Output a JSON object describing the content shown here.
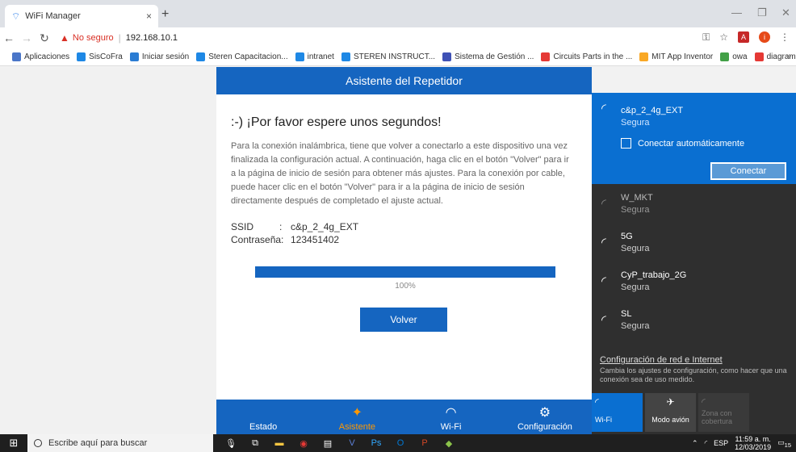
{
  "browser": {
    "tab_title": "WiFi Manager",
    "tab_close": "×",
    "new_tab": "+",
    "security_label": "No seguro",
    "url": "192.168.10.1",
    "bookmarks": [
      {
        "label": "Aplicaciones",
        "color": "#4a76c8"
      },
      {
        "label": "SisCoFra",
        "color": "#1e88e5"
      },
      {
        "label": "Iniciar sesión",
        "color": "#2b7cd3"
      },
      {
        "label": "Steren Capacitacion...",
        "color": "#1e88e5"
      },
      {
        "label": "intranet",
        "color": "#1e88e5"
      },
      {
        "label": "STEREN INSTRUCT...",
        "color": "#1e88e5"
      },
      {
        "label": "Sistema de Gestión ...",
        "color": "#3f51b5"
      },
      {
        "label": "Circuits Parts in the ...",
        "color": "#e53935"
      },
      {
        "label": "MIT App Inventor",
        "color": "#f9a825"
      },
      {
        "label": "owa",
        "color": "#43a047"
      },
      {
        "label": "diagramaOnline",
        "color": "#e53935"
      }
    ],
    "bookmarks_more": "»"
  },
  "page": {
    "header": "Asistente del Repetidor",
    "title": ":-) ¡Por favor espere unos segundos!",
    "paragraph": "Para la conexión inalámbrica, tiene que volver a conectarlo a este dispositivo una vez finalizada la configuración actual. A continuación, haga clic en el botón \"Volver\" para ir a la página de inicio de sesión para obtener más ajustes. Para la conexión por cable, puede hacer clic en el botón \"Volver\" para ir a la página de inicio de sesión directamente después de completado el ajuste actual.",
    "ssid_label": "SSID",
    "ssid_sep": ":",
    "ssid_value": "c&p_2_4g_EXT",
    "password_label": "Contraseña:",
    "password_value": "123451402",
    "progress_percent": 100,
    "progress_text": "100%",
    "back_button": "Volver",
    "nav": [
      {
        "label": "Estado",
        "icon": ""
      },
      {
        "label": "Asistente",
        "icon": "✦"
      },
      {
        "label": "Wi-Fi",
        "icon": "◠"
      },
      {
        "label": "Configuración",
        "icon": "⚙"
      }
    ],
    "accent_color": "#1565c0",
    "active_nav_color": "#ff9800"
  },
  "wifi_panel": {
    "selected": {
      "name": "c&p_2_4g_EXT",
      "security": "Segura",
      "auto_connect_label": "Conectar automáticamente",
      "connect_button": "Conectar"
    },
    "networks": [
      {
        "name": "W_MKT",
        "security": "Segura",
        "dim": true
      },
      {
        "name": "5G",
        "security": "Segura",
        "dim": false
      },
      {
        "name": "CyP_trabajo_2G",
        "security": "Segura",
        "dim": false
      },
      {
        "name": "SL",
        "security": "Segura",
        "dim": false
      }
    ],
    "settings_link": "Configuración de red e Internet",
    "settings_desc": "Cambia los ajustes de configuración, como hacer que una conexión sea de uso medido.",
    "quick_wifi": "Wi-Fi",
    "quick_airplane": "Modo avión",
    "quick_hotspot": "Zona con cobertura"
  },
  "taskbar": {
    "search_placeholder": "Escribe aquí para buscar",
    "lang": "ESP",
    "time": "11:59 a. m.",
    "date": "12/03/2019",
    "notif_count": "15"
  }
}
